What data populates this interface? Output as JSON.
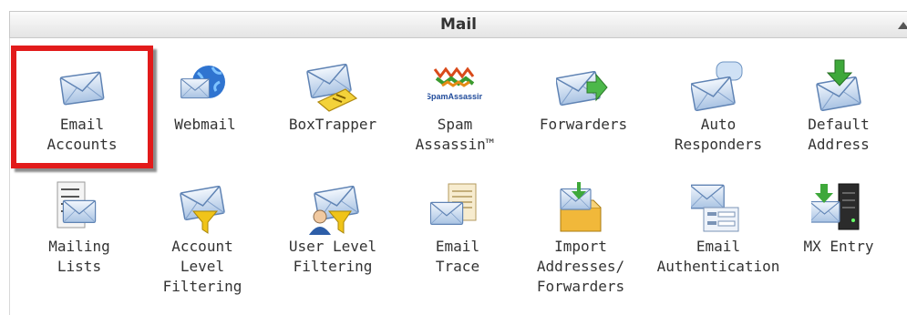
{
  "panel": {
    "title": "Mail"
  },
  "items": [
    {
      "label": "Email\nAccounts",
      "icon": "envelope-icon"
    },
    {
      "label": "Webmail",
      "icon": "globe-envelope-icon"
    },
    {
      "label": "BoxTrapper",
      "icon": "envelope-trap-icon"
    },
    {
      "label": "Spam\nAssassin™",
      "icon": "spamassassin-logo-icon",
      "logo_text": "SpamAssassin"
    },
    {
      "label": "Forwarders",
      "icon": "envelope-forward-arrow-icon"
    },
    {
      "label": "Auto\nResponders",
      "icon": "envelope-speech-bubble-icon"
    },
    {
      "label": "Default\nAddress",
      "icon": "envelope-download-arrow-icon"
    },
    {
      "label": "Mailing\nLists",
      "icon": "list-envelope-icon"
    },
    {
      "label": "Account\nLevel\nFiltering",
      "icon": "envelope-funnel-icon"
    },
    {
      "label": "User Level\nFiltering",
      "icon": "user-envelope-icon"
    },
    {
      "label": "Email\nTrace",
      "icon": "document-envelope-icon"
    },
    {
      "label": "Import\nAddresses/\nForwarders",
      "icon": "box-import-icon"
    },
    {
      "label": "Email\nAuthentication",
      "icon": "envelope-form-icon"
    },
    {
      "label": "MX Entry",
      "icon": "server-envelope-icon"
    }
  ]
}
